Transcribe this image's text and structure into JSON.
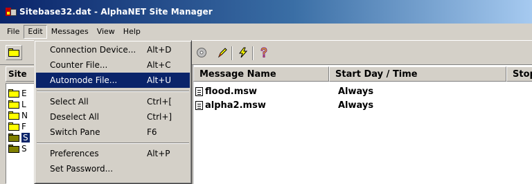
{
  "window": {
    "title": "Sitebase32.dat - AlphaNET Site Manager"
  },
  "menubar": {
    "items": [
      {
        "label": "File"
      },
      {
        "label": "Edit"
      },
      {
        "label": "Messages"
      },
      {
        "label": "View"
      },
      {
        "label": "Help"
      }
    ]
  },
  "toolbar": {
    "icons": [
      "open-folder-icon",
      "disc-icon",
      "pencil-icon",
      "lightning-icon",
      "help-icon"
    ]
  },
  "left_pane": {
    "header": "Site",
    "tree": [
      {
        "label": "E",
        "icon": "folder-icon"
      },
      {
        "label": "L",
        "icon": "folder-icon"
      },
      {
        "label": "N",
        "icon": "folder-icon"
      },
      {
        "label": "F",
        "icon": "folder-icon"
      },
      {
        "label": "S",
        "icon": "open-folder-icon",
        "selected": true
      },
      {
        "label": "S",
        "icon": "folder-icon"
      }
    ]
  },
  "right_pane": {
    "columns": [
      {
        "label": "Message Name"
      },
      {
        "label": "Start Day / Time"
      },
      {
        "label": "Stop Day / Time"
      }
    ],
    "rows": [
      {
        "name": "flood.msw",
        "start": "Always"
      },
      {
        "name": "alpha2.msw",
        "start": "Always"
      }
    ]
  },
  "edit_menu": {
    "groups": [
      [
        {
          "label": "Connection Device...",
          "shortcut": "Alt+D"
        },
        {
          "label": "Counter File...",
          "shortcut": "Alt+C"
        },
        {
          "label": "Automode File...",
          "shortcut": "Alt+U",
          "highlighted": true
        }
      ],
      [
        {
          "label": "Select All",
          "shortcut": "Ctrl+["
        },
        {
          "label": "Deselect All",
          "shortcut": "Ctrl+]"
        },
        {
          "label": "Switch Pane",
          "shortcut": "F6"
        }
      ],
      [
        {
          "label": "Preferences",
          "shortcut": "Alt+P"
        },
        {
          "label": "Set Password...",
          "shortcut": ""
        }
      ]
    ]
  },
  "colors": {
    "title_bar": "#0a246a",
    "menu_highlight": "#0a246a",
    "chrome": "#d4d0c8",
    "folder": "#ffff00"
  }
}
